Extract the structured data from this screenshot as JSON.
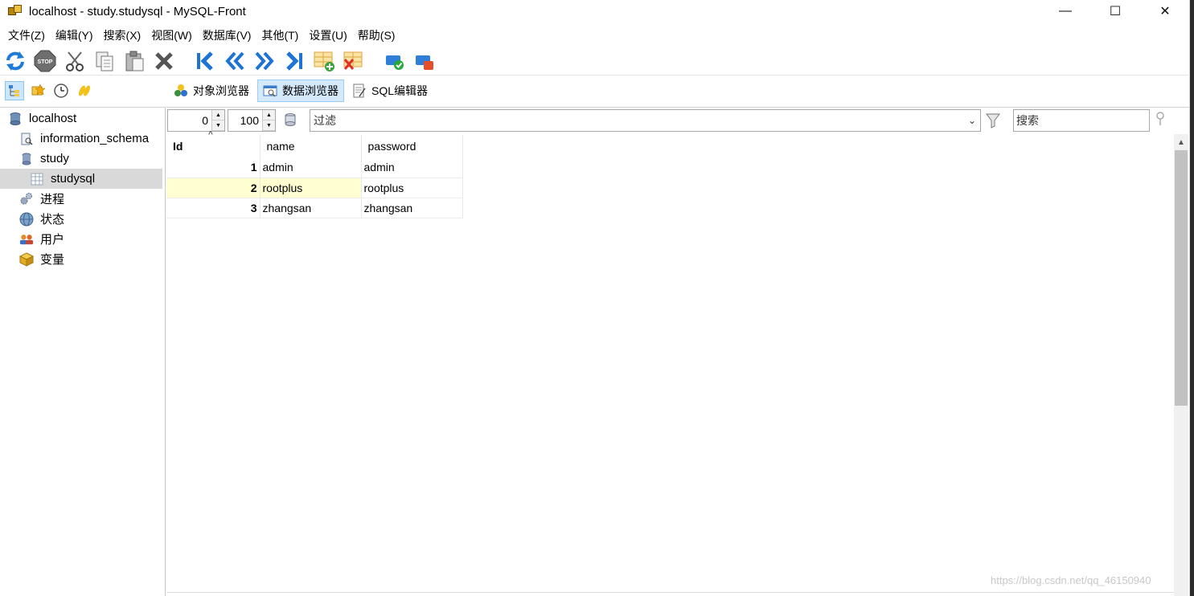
{
  "window": {
    "title": "localhost - study.studysql - MySQL-Front",
    "minimize": "—",
    "maximize": "☐",
    "close": "✕"
  },
  "menu": [
    "文件(Z)",
    "编辑(Y)",
    "搜索(X)",
    "视图(W)",
    "数据库(V)",
    "其他(T)",
    "设置(U)",
    "帮助(S)"
  ],
  "toolbar": {
    "icons": [
      "refresh-icon",
      "stop-icon",
      "cut-icon",
      "copy-icon",
      "paste-icon",
      "delete-icon",
      "first-record-icon",
      "prev-record-icon",
      "next-record-icon",
      "last-record-icon",
      "insert-row-icon",
      "delete-row-icon",
      "commit-icon",
      "rollback-icon"
    ],
    "stop_label": "STOP"
  },
  "tabs": {
    "object_browser": "对象浏览器",
    "data_browser": "数据浏览器",
    "sql_editor": "SQL编辑器"
  },
  "sidebar": {
    "items": [
      {
        "label": "localhost"
      },
      {
        "label": "information_schema"
      },
      {
        "label": "study"
      },
      {
        "label": "studysql"
      },
      {
        "label": "进程"
      },
      {
        "label": "状态"
      },
      {
        "label": "用户"
      },
      {
        "label": "变量"
      }
    ]
  },
  "filter": {
    "offset": "0",
    "limit": "100",
    "filter_placeholder": "过滤",
    "search_placeholder": "搜索"
  },
  "table": {
    "columns": [
      "Id",
      "name",
      "password"
    ],
    "rows": [
      {
        "id": "1",
        "name": "admin",
        "password": "admin"
      },
      {
        "id": "2",
        "name": "rootplus",
        "password": "rootplus"
      },
      {
        "id": "3",
        "name": "zhangsan",
        "password": "zhangsan"
      }
    ]
  },
  "watermark": "https://blog.csdn.net/qq_46150940",
  "colors": {
    "highlight_row": "#ffffd2",
    "active_tab": "#d4e9fb",
    "accent_blue": "#1e73d6"
  }
}
